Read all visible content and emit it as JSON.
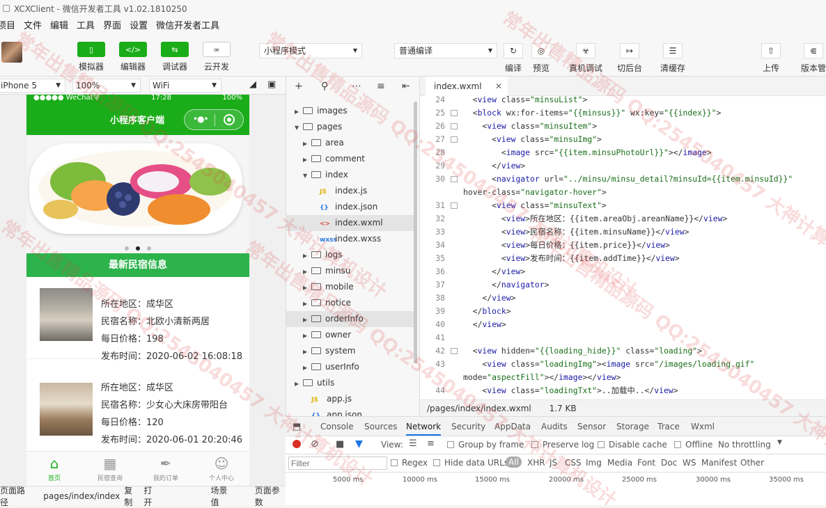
{
  "titlebar": {
    "title": "XCXClient - 微信开发者工具 v1.02.1810250"
  },
  "menu": [
    "项目",
    "文件",
    "编辑",
    "工具",
    "界面",
    "设置",
    "微信开发者工具"
  ],
  "toolbar": {
    "simulator": "模拟器",
    "editor": "编辑器",
    "debugger": "调试器",
    "cloud": "云开发",
    "mode": "小程序模式",
    "compile": "普通编译",
    "compile_btn": "编译",
    "preview": "预览",
    "real_debug": "真机调试",
    "background": "切后台",
    "clear_cache": "清缓存",
    "upload": "上传",
    "version": "版本管理"
  },
  "device": {
    "model": "iPhone 5",
    "zoom": "100%",
    "network": "WiFi"
  },
  "phone": {
    "status_left": "●●●●● WeChat令",
    "status_time": "17:28",
    "status_right": "100%",
    "nav_title": "小程序客户端",
    "section_title": "最新民宿信息",
    "items": [
      {
        "area": "所在地区：成华区",
        "name": "民宿名称：北欧小清新两居",
        "price": "每日价格：198",
        "time": "发布时间：2020-06-02 16:08:18"
      },
      {
        "area": "所在地区：成华区",
        "name": "民宿名称：少女心大床房带阳台",
        "price": "每日价格：120",
        "time": "发布时间：2020-06-01 20:20:46"
      }
    ],
    "tabs": [
      "首页",
      "民宿查询",
      "我的订单",
      "个人中心"
    ]
  },
  "bottombar": {
    "path_label": "页面路径",
    "path": "pages/index/index",
    "copy": "复制",
    "open": "打开",
    "scene": "场景值",
    "params": "页面参数"
  },
  "tree": [
    {
      "name": "images",
      "type": "folder",
      "state": "closed",
      "depth": 0
    },
    {
      "name": "pages",
      "type": "folder",
      "state": "open",
      "depth": 0
    },
    {
      "name": "area",
      "type": "folder",
      "state": "closed",
      "depth": 1
    },
    {
      "name": "comment",
      "type": "folder",
      "state": "closed",
      "depth": 1
    },
    {
      "name": "index",
      "type": "folder",
      "state": "open",
      "depth": 1
    },
    {
      "name": "index.js",
      "type": "JS",
      "depth": 2
    },
    {
      "name": "index.json",
      "type": "{}",
      "depth": 2
    },
    {
      "name": "index.wxml",
      "type": "<>",
      "depth": 2,
      "selected": true
    },
    {
      "name": "index.wxss",
      "type": "wxss",
      "depth": 2
    },
    {
      "name": "logs",
      "type": "folder",
      "state": "closed",
      "depth": 1
    },
    {
      "name": "minsu",
      "type": "folder",
      "state": "closed",
      "depth": 1
    },
    {
      "name": "mobile",
      "type": "folder",
      "state": "closed",
      "depth": 1
    },
    {
      "name": "notice",
      "type": "folder",
      "state": "closed",
      "depth": 1
    },
    {
      "name": "orderInfo",
      "type": "folder",
      "state": "closed",
      "depth": 1,
      "hover": true
    },
    {
      "name": "owner",
      "type": "folder",
      "state": "closed",
      "depth": 1
    },
    {
      "name": "system",
      "type": "folder",
      "state": "closed",
      "depth": 1
    },
    {
      "name": "userInfo",
      "type": "folder",
      "state": "closed",
      "depth": 1
    },
    {
      "name": "utils",
      "type": "folder",
      "state": "closed",
      "depth": 0
    },
    {
      "name": "app.js",
      "type": "JS",
      "depth": 1
    },
    {
      "name": "app.json",
      "type": "{}",
      "depth": 1
    }
  ],
  "editor": {
    "tab": "index.wxml",
    "footer_path": "/pages/index/index.wxml",
    "footer_size": "1.7 KB",
    "lines": [
      {
        "n": "24",
        "fold": false,
        "code": "  <view class=\"minsuList\">"
      },
      {
        "n": "25",
        "fold": true,
        "code": "  <block wx:for-items=\"{{minsus}}\" wx:key=\"{{index}}\">"
      },
      {
        "n": "26",
        "fold": true,
        "code": "    <view class=\"minsuItem\">"
      },
      {
        "n": "27",
        "fold": true,
        "code": "      <view class=\"minsuImg\">"
      },
      {
        "n": "28",
        "fold": false,
        "code": "        <image src=\"{{item.minsuPhotoUrl}}\"></image>"
      },
      {
        "n": "29",
        "fold": false,
        "code": "      </view>"
      },
      {
        "n": "30",
        "fold": true,
        "code": "      <navigator url=\"../minsu/minsu_detail?minsuId={{item.minsuId}}\""
      },
      {
        "n": "",
        "fold": false,
        "code": "hover-class=\"navigator-hover\">"
      },
      {
        "n": "31",
        "fold": true,
        "code": "      <view class=\"minsuText\">"
      },
      {
        "n": "32",
        "fold": false,
        "code": "        <view>所在地区：{{item.areaObj.areanName}}</view>"
      },
      {
        "n": "33",
        "fold": false,
        "code": "        <view>民宿名称：{{item.minsuName}}</view>"
      },
      {
        "n": "34",
        "fold": false,
        "code": "        <view>每日价格：{{item.price}}</view>"
      },
      {
        "n": "35",
        "fold": false,
        "code": "        <view>发布时间：{{item.addTime}}</view>"
      },
      {
        "n": "36",
        "fold": false,
        "code": "      </view>"
      },
      {
        "n": "37",
        "fold": false,
        "code": "      </navigator>"
      },
      {
        "n": "38",
        "fold": false,
        "code": "    </view>"
      },
      {
        "n": "39",
        "fold": false,
        "code": "  </block>"
      },
      {
        "n": "40",
        "fold": false,
        "code": "  </view>"
      },
      {
        "n": "41",
        "fold": false,
        "code": ""
      },
      {
        "n": "42",
        "fold": true,
        "code": "  <view hidden=\"{{loading_hide}}\" class=\"loading\">"
      },
      {
        "n": "43",
        "fold": false,
        "code": "    <view class=\"loadingImg\"><image src=\"/images/loading.gif\""
      },
      {
        "n": "",
        "fold": false,
        "code": "mode=\"aspectFill\"></image></view>"
      },
      {
        "n": "44",
        "fold": false,
        "code": "    <view class=\"loadingTxt\">..加载中..</view>"
      }
    ]
  },
  "devtools": {
    "tabs": [
      "Console",
      "Sources",
      "Network",
      "Security",
      "AppData",
      "Audits",
      "Sensor",
      "Storage",
      "Trace",
      "Wxml"
    ],
    "view_label": "View:",
    "group_by_frame": "Group by frame",
    "preserve_log": "Preserve log",
    "disable_cache": "Disable cache",
    "offline": "Offline",
    "throttling": "No throttling",
    "filter_placeholder": "Filter",
    "regex": "Regex",
    "hide_data_urls": "Hide data URLs",
    "types": [
      "All",
      "XHR",
      "JS",
      "CSS",
      "Img",
      "Media",
      "Font",
      "Doc",
      "WS",
      "Manifest",
      "Other"
    ],
    "timeline": [
      "5000 ms",
      "10000 ms",
      "15000 ms",
      "20000 ms",
      "25000 ms",
      "30000 ms",
      "35000 ms"
    ]
  },
  "watermark": {
    "text": "常年出售精品源码 QQ:2545040457 大神计算机设计"
  },
  "colors": {
    "wechat_green": "#1aad19",
    "section_green": "#2cb34b"
  }
}
